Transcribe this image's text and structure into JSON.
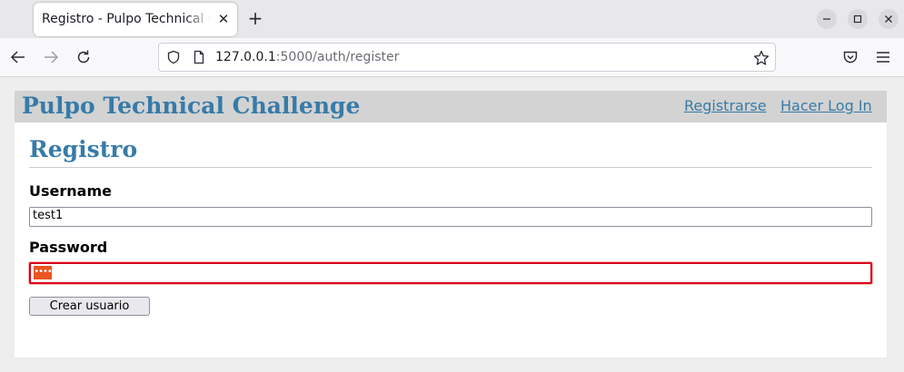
{
  "browser": {
    "tab_title": "Registro - Pulpo Technical Challenge",
    "tab_close": "✕",
    "new_tab": "+",
    "url_host": "127.0.0.1",
    "url_rest": ":5000/auth/register"
  },
  "site": {
    "title": "Pulpo Technical Challenge",
    "nav": {
      "register": "Registrarse",
      "login": "Hacer Log In"
    }
  },
  "form": {
    "heading": "Registro",
    "username_label": "Username",
    "username_value": "test1",
    "password_label": "Password",
    "password_mask": "••••",
    "submit_label": "Crear usuario"
  },
  "colors": {
    "link": "#377ba8",
    "header_bg": "#d3d3d3",
    "invalid_border": "#d70022",
    "autofill_highlight": "#e95420"
  },
  "icons": [
    "back-arrow-icon",
    "forward-arrow-icon",
    "reload-icon",
    "shield-icon",
    "page-icon",
    "bookmark-star-icon",
    "pocket-icon",
    "menu-icon",
    "minimize-icon",
    "maximize-icon",
    "close-window-icon"
  ]
}
